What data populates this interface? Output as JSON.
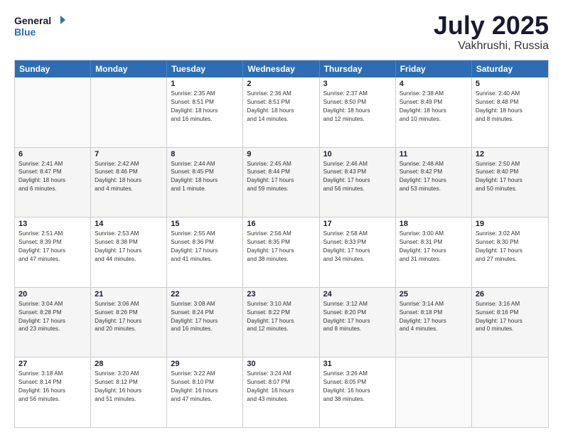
{
  "logo": {
    "line1": "General",
    "line2": "Blue"
  },
  "title": "July 2025",
  "location": "Vakhrushi, Russia",
  "header": {
    "days": [
      "Sunday",
      "Monday",
      "Tuesday",
      "Wednesday",
      "Thursday",
      "Friday",
      "Saturday"
    ]
  },
  "rows": [
    [
      {
        "day": "",
        "text": ""
      },
      {
        "day": "",
        "text": ""
      },
      {
        "day": "1",
        "text": "Sunrise: 2:35 AM\nSunset: 8:51 PM\nDaylight: 18 hours\nand 16 minutes."
      },
      {
        "day": "2",
        "text": "Sunrise: 2:36 AM\nSunset: 8:51 PM\nDaylight: 18 hours\nand 14 minutes."
      },
      {
        "day": "3",
        "text": "Sunrise: 2:37 AM\nSunset: 8:50 PM\nDaylight: 18 hours\nand 12 minutes."
      },
      {
        "day": "4",
        "text": "Sunrise: 2:38 AM\nSunset: 8:49 PM\nDaylight: 18 hours\nand 10 minutes."
      },
      {
        "day": "5",
        "text": "Sunrise: 2:40 AM\nSunset: 8:48 PM\nDaylight: 18 hours\nand 8 minutes."
      }
    ],
    [
      {
        "day": "6",
        "text": "Sunrise: 2:41 AM\nSunset: 8:47 PM\nDaylight: 18 hours\nand 6 minutes."
      },
      {
        "day": "7",
        "text": "Sunrise: 2:42 AM\nSunset: 8:46 PM\nDaylight: 18 hours\nand 4 minutes."
      },
      {
        "day": "8",
        "text": "Sunrise: 2:44 AM\nSunset: 8:45 PM\nDaylight: 18 hours\nand 1 minute."
      },
      {
        "day": "9",
        "text": "Sunrise: 2:45 AM\nSunset: 8:44 PM\nDaylight: 17 hours\nand 59 minutes."
      },
      {
        "day": "10",
        "text": "Sunrise: 2:46 AM\nSunset: 8:43 PM\nDaylight: 17 hours\nand 56 minutes."
      },
      {
        "day": "11",
        "text": "Sunrise: 2:48 AM\nSunset: 8:42 PM\nDaylight: 17 hours\nand 53 minutes."
      },
      {
        "day": "12",
        "text": "Sunrise: 2:50 AM\nSunset: 8:40 PM\nDaylight: 17 hours\nand 50 minutes."
      }
    ],
    [
      {
        "day": "13",
        "text": "Sunrise: 2:51 AM\nSunset: 8:39 PM\nDaylight: 17 hours\nand 47 minutes."
      },
      {
        "day": "14",
        "text": "Sunrise: 2:53 AM\nSunset: 8:38 PM\nDaylight: 17 hours\nand 44 minutes."
      },
      {
        "day": "15",
        "text": "Sunrise: 2:55 AM\nSunset: 8:36 PM\nDaylight: 17 hours\nand 41 minutes."
      },
      {
        "day": "16",
        "text": "Sunrise: 2:56 AM\nSunset: 8:35 PM\nDaylight: 17 hours\nand 38 minutes."
      },
      {
        "day": "17",
        "text": "Sunrise: 2:58 AM\nSunset: 8:33 PM\nDaylight: 17 hours\nand 34 minutes."
      },
      {
        "day": "18",
        "text": "Sunrise: 3:00 AM\nSunset: 8:31 PM\nDaylight: 17 hours\nand 31 minutes."
      },
      {
        "day": "19",
        "text": "Sunrise: 3:02 AM\nSunset: 8:30 PM\nDaylight: 17 hours\nand 27 minutes."
      }
    ],
    [
      {
        "day": "20",
        "text": "Sunrise: 3:04 AM\nSunset: 8:28 PM\nDaylight: 17 hours\nand 23 minutes."
      },
      {
        "day": "21",
        "text": "Sunrise: 3:06 AM\nSunset: 8:26 PM\nDaylight: 17 hours\nand 20 minutes."
      },
      {
        "day": "22",
        "text": "Sunrise: 3:08 AM\nSunset: 8:24 PM\nDaylight: 17 hours\nand 16 minutes."
      },
      {
        "day": "23",
        "text": "Sunrise: 3:10 AM\nSunset: 8:22 PM\nDaylight: 17 hours\nand 12 minutes."
      },
      {
        "day": "24",
        "text": "Sunrise: 3:12 AM\nSunset: 8:20 PM\nDaylight: 17 hours\nand 8 minutes."
      },
      {
        "day": "25",
        "text": "Sunrise: 3:14 AM\nSunset: 8:18 PM\nDaylight: 17 hours\nand 4 minutes."
      },
      {
        "day": "26",
        "text": "Sunrise: 3:16 AM\nSunset: 8:16 PM\nDaylight: 17 hours\nand 0 minutes."
      }
    ],
    [
      {
        "day": "27",
        "text": "Sunrise: 3:18 AM\nSunset: 8:14 PM\nDaylight: 16 hours\nand 56 minutes."
      },
      {
        "day": "28",
        "text": "Sunrise: 3:20 AM\nSunset: 8:12 PM\nDaylight: 16 hours\nand 51 minutes."
      },
      {
        "day": "29",
        "text": "Sunrise: 3:22 AM\nSunset: 8:10 PM\nDaylight: 16 hours\nand 47 minutes."
      },
      {
        "day": "30",
        "text": "Sunrise: 3:24 AM\nSunset: 8:07 PM\nDaylight: 16 hours\nand 43 minutes."
      },
      {
        "day": "31",
        "text": "Sunrise: 3:26 AM\nSunset: 8:05 PM\nDaylight: 16 hours\nand 38 minutes."
      },
      {
        "day": "",
        "text": ""
      },
      {
        "day": "",
        "text": ""
      }
    ]
  ]
}
